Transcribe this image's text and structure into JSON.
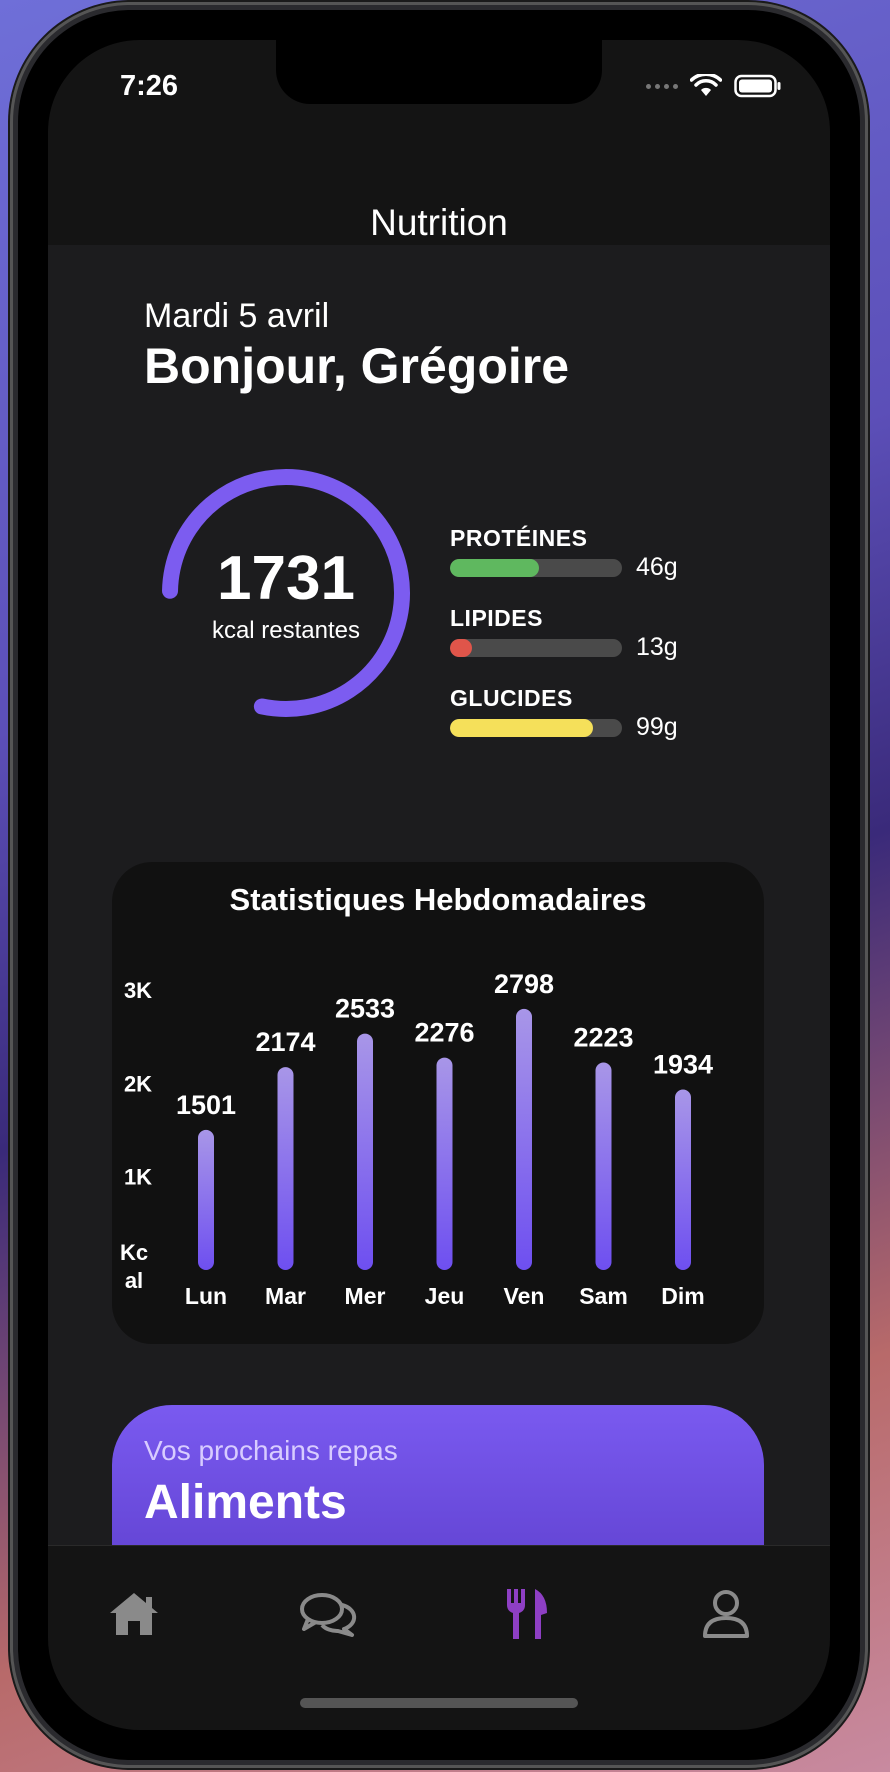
{
  "status": {
    "time": "7:26"
  },
  "header": {
    "title": "Nutrition"
  },
  "greeting": {
    "date": "Mardi 5 avril",
    "text": "Bonjour, Grégoire"
  },
  "calories": {
    "remaining": "1731",
    "label": "kcal restantes",
    "ring_progress": 0.78,
    "ring_color": "#7c5cf0"
  },
  "macros": [
    {
      "name": "PROTÉINES",
      "value": "46g",
      "fill": 0.52,
      "color": "#5fb85f"
    },
    {
      "name": "LIPIDES",
      "value": "13g",
      "fill": 0.13,
      "color": "#e0554a"
    },
    {
      "name": "GLUCIDES",
      "value": "99g",
      "fill": 0.83,
      "color": "#f5e05a"
    }
  ],
  "chart_data": {
    "type": "bar",
    "title": "Statistiques Hebdomadaires",
    "categories": [
      "Lun",
      "Mar",
      "Mer",
      "Jeu",
      "Ven",
      "Sam",
      "Dim"
    ],
    "values": [
      1501,
      2174,
      2533,
      2276,
      2798,
      2223,
      1934
    ],
    "y_ticks": [
      "3K",
      "2K",
      "1K"
    ],
    "ylabel": "Kc al",
    "ylim": [
      0,
      3000
    ],
    "grid": false,
    "bar_color_top": "#a896e8",
    "bar_color_bottom": "#6e4ff0"
  },
  "meals": {
    "subtitle": "Vos prochains repas",
    "title": "Aliments"
  },
  "tabs": [
    {
      "name": "home",
      "icon": "home-icon",
      "active": false
    },
    {
      "name": "chat",
      "icon": "chat-bubbles-icon",
      "active": false
    },
    {
      "name": "nutrition",
      "icon": "fork-knife-icon",
      "active": true
    },
    {
      "name": "profile",
      "icon": "person-icon",
      "active": false
    }
  ],
  "colors": {
    "accent": "#7c5cf0",
    "active_tab": "#8e3fc4",
    "inactive_tab": "#8a8a8a"
  }
}
